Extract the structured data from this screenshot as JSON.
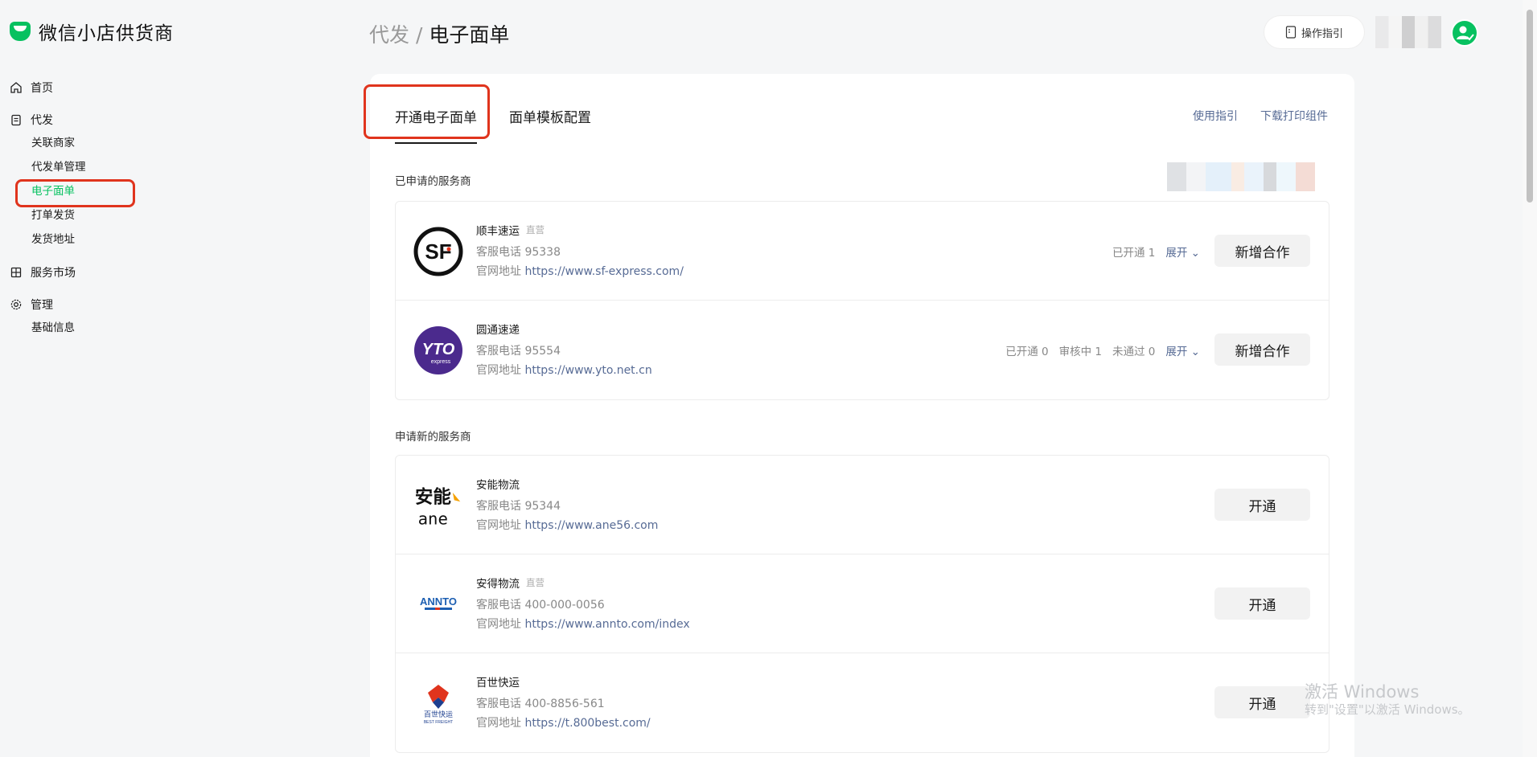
{
  "brand": {
    "name": "微信小店供货商",
    "color": "#07c160"
  },
  "sidebar": {
    "groups": [
      {
        "label": "首页",
        "icon": "home-icon",
        "items": []
      },
      {
        "label": "代发",
        "icon": "clipboard-icon",
        "items": [
          "关联商家",
          "代发单管理",
          "电子面单",
          "打单发货",
          "发货地址"
        ]
      },
      {
        "label": "服务市场",
        "icon": "grid-icon",
        "items": []
      },
      {
        "label": "管理",
        "icon": "gear-icon",
        "items": [
          "基础信息"
        ]
      }
    ],
    "active": "电子面单"
  },
  "header": {
    "breadcrumb_parent": "代发",
    "breadcrumb_sep": "/",
    "breadcrumb_current": "电子面单",
    "guide_label": "操作指引"
  },
  "tabs": {
    "active": "开通电子面单",
    "second": "面单模板配置"
  },
  "links": {
    "guide": "使用指引",
    "download": "下载打印组件"
  },
  "sections": {
    "applied_title": "已申请的服务商",
    "new_title": "申请新的服务商"
  },
  "applied": [
    {
      "name": "顺丰速运",
      "tag": "直营",
      "phone_label": "客服电话",
      "phone": "95338",
      "site_label": "官网地址",
      "site": "https://www.sf-express.com/",
      "status": [
        "已开通 1"
      ],
      "expand": "展开",
      "action": "新增合作"
    },
    {
      "name": "圆通速递",
      "tag": "",
      "phone_label": "客服电话",
      "phone": "95554",
      "site_label": "官网地址",
      "site": "https://www.yto.net.cn",
      "status": [
        "已开通 0",
        "审核中 1",
        "未通过 0"
      ],
      "expand": "展开",
      "action": "新增合作"
    }
  ],
  "new_providers": [
    {
      "name": "安能物流",
      "tag": "",
      "phone_label": "客服电话",
      "phone": "95344",
      "site_label": "官网地址",
      "site": "https://www.ane56.com",
      "action": "开通"
    },
    {
      "name": "安得物流",
      "tag": "直营",
      "phone_label": "客服电话",
      "phone": "400-000-0056",
      "site_label": "官网地址",
      "site": "https://www.annto.com/index",
      "action": "开通"
    },
    {
      "name": "百世快运",
      "tag": "",
      "phone_label": "客服电话",
      "phone": "400-8856-561",
      "site_label": "官网地址",
      "site": "https://t.800best.com/",
      "action": "开通"
    }
  ],
  "logos": {
    "sf": "SF",
    "yto": "YTO",
    "yto_sub": "express",
    "ane": "安能",
    "ane_sub": "ane",
    "annto": "ANNTO",
    "best": "百世快运",
    "best_sub": "BEST FREIGHT"
  },
  "watermark": {
    "line1": "激活 Windows",
    "line2": "转到\"设置\"以激活 Windows。"
  }
}
